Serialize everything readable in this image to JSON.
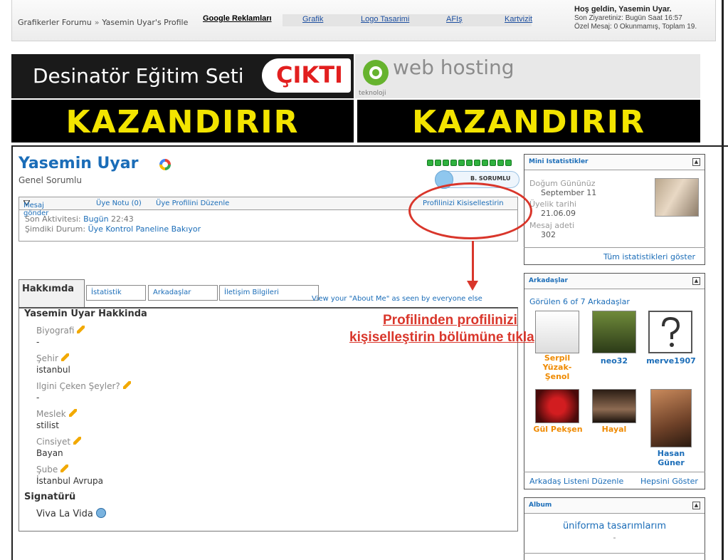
{
  "topbar": {
    "breadcrumb_forum": "Grafikerler Forumu",
    "breadcrumb_sep": "»",
    "breadcrumb_profile": "Yasemin Uyar's Profile",
    "ads_label": "Google Reklamları",
    "links": [
      "Grafik",
      "Logo Tasarimi",
      "AFIş",
      "Kartvizit"
    ],
    "welcome_title": "Hoş geldin, Yasemin Uyar.",
    "last_visit": "Son Ziyaretiniz: Bugün Saat 16:57",
    "pm_status": "Özel Mesaj: 0 Okunmamış, Toplam 19."
  },
  "ad": {
    "left_text": "Desinatör Eğitim Seti",
    "badge": "ÇIKTI",
    "right_text": "web hosting",
    "right_sub": "teknoloji",
    "kazandirir_left": "KAZANDIRIR",
    "kazandirir_right": "KAZANDIRIR"
  },
  "profile": {
    "name": "Yasemin Uyar",
    "title": "Genel Sorumlu",
    "award_text": "B. SORUMLU",
    "actions": {
      "send_message": "Mesaj gönder",
      "member_note": "Üye Notu (0)",
      "edit_profile": "Üye Profilini Düzenle",
      "customize": "Profilinizi Kisisellestirin"
    },
    "last_activity_label": "Son Aktivitesi:",
    "last_activity_value": "Bugün",
    "last_activity_time": "22:43",
    "current_status_label": "Şimdiki Durum:",
    "current_status_value": "Üye Kontrol Paneline Bakıyor"
  },
  "tabs": [
    "Hakkımda",
    "İstatistik",
    "Arkadaşlar",
    "İletişim Bilgileri"
  ],
  "about": {
    "view_link": "View your \"About Me\" as seen by everyone else",
    "heading": "Yasemin Uyar Hakkinda",
    "fields": [
      {
        "label": "Biyografi",
        "value": "-"
      },
      {
        "label": "Şehir",
        "value": "istanbul"
      },
      {
        "label": "Ilgini Çeken Şeyler?",
        "value": "-"
      },
      {
        "label": "Meslek",
        "value": "stilist"
      },
      {
        "label": "Cinsiyet",
        "value": "Bayan"
      },
      {
        "label": "Şube",
        "value": "İstanbul Avrupa"
      }
    ],
    "signature_heading": "Signatürü",
    "signature_value": "Viva La Vida"
  },
  "sidebar": {
    "mini_stats": {
      "title": "Mini Istatistikler",
      "birthday_label": "Doğum Gününüz",
      "birthday_value": "September 11",
      "join_label": "Üyelik tarihi",
      "join_value": "21.06.09",
      "posts_label": "Mesaj adeti",
      "posts_value": "302",
      "show_all": "Tüm istatistikleri göster"
    },
    "friends": {
      "title": "Arkadaşlar",
      "shown": "Görülen 6 of 7 Arkadaşlar",
      "list": [
        {
          "name": "Serpil Yüzak-Şenol",
          "color": "#ef8a00"
        },
        {
          "name": "neo32",
          "color": "#1b6db8"
        },
        {
          "name": "merve1907",
          "color": "#1b6db8"
        },
        {
          "name": "Gül Pekşen",
          "color": "#ef8a00"
        },
        {
          "name": "Hayal",
          "color": "#ef8a00"
        },
        {
          "name": "Hasan Güner",
          "color": "#1b6db8"
        }
      ],
      "edit_list": "Arkadaş Listeni Düzenle",
      "show_all": "Hepsini Göster"
    },
    "album": {
      "title": "Album",
      "album_name": "üniforma tasarımlarım",
      "album_sub": "-"
    }
  },
  "annotation": {
    "line1": "Profilinden profilinizi",
    "line2": "kişiselleştirin bölümüne tıkla"
  }
}
